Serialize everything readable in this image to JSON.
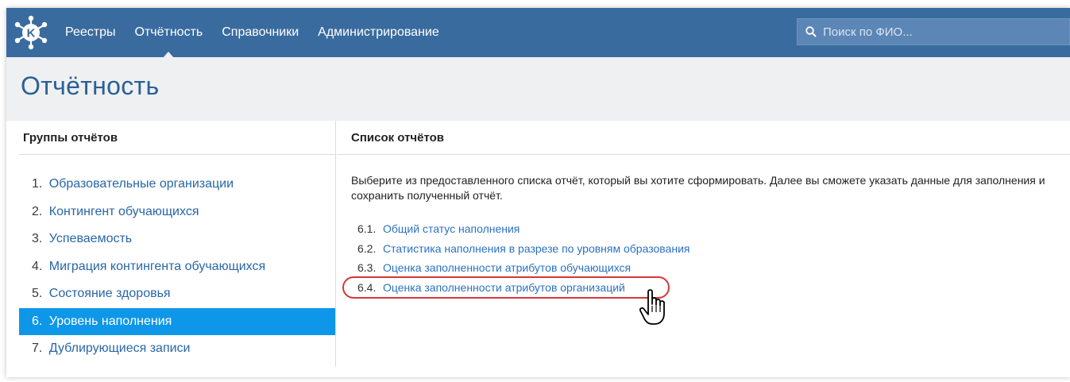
{
  "nav": {
    "items": [
      "Реестры",
      "Отчётность",
      "Справочники",
      "Администрирование"
    ],
    "active_index": 1
  },
  "search": {
    "placeholder": "Поиск по ФИО..."
  },
  "page": {
    "title": "Отчётность"
  },
  "groups": {
    "header": "Группы отчётов",
    "items": [
      {
        "num": "1.",
        "label": "Образовательные организации"
      },
      {
        "num": "2.",
        "label": "Контингент обучающихся"
      },
      {
        "num": "3.",
        "label": "Успеваемость"
      },
      {
        "num": "4.",
        "label": "Миграция контингента обучающихся"
      },
      {
        "num": "5.",
        "label": "Состояние здоровья"
      },
      {
        "num": "6.",
        "label": "Уровень наполнения"
      },
      {
        "num": "7.",
        "label": "Дублирующиеся записи"
      }
    ],
    "active_index": 5
  },
  "reports": {
    "header": "Список отчётов",
    "intro": "Выберите из предоставленного списка отчёт, который вы хотите сформировать. Далее вы сможете указать данные для заполнения и сохранить полученный отчёт.",
    "items": [
      {
        "num": "6.1.",
        "label": "Общий статус наполнения"
      },
      {
        "num": "6.2.",
        "label": "Статистика наполнения в разрезе по уровням образования"
      },
      {
        "num": "6.3.",
        "label": "Оценка заполненности атрибутов обучающихся"
      },
      {
        "num": "6.4.",
        "label": "Оценка заполненности атрибутов организаций"
      }
    ],
    "highlighted_index": 3
  },
  "colors": {
    "header_bg": "#3a6b9f",
    "active_group_bg": "#0e97e8",
    "link": "#2a72c2",
    "highlight": "#d6363a"
  },
  "icons": [
    "logo-icon",
    "search-icon",
    "hand-cursor-icon"
  ]
}
